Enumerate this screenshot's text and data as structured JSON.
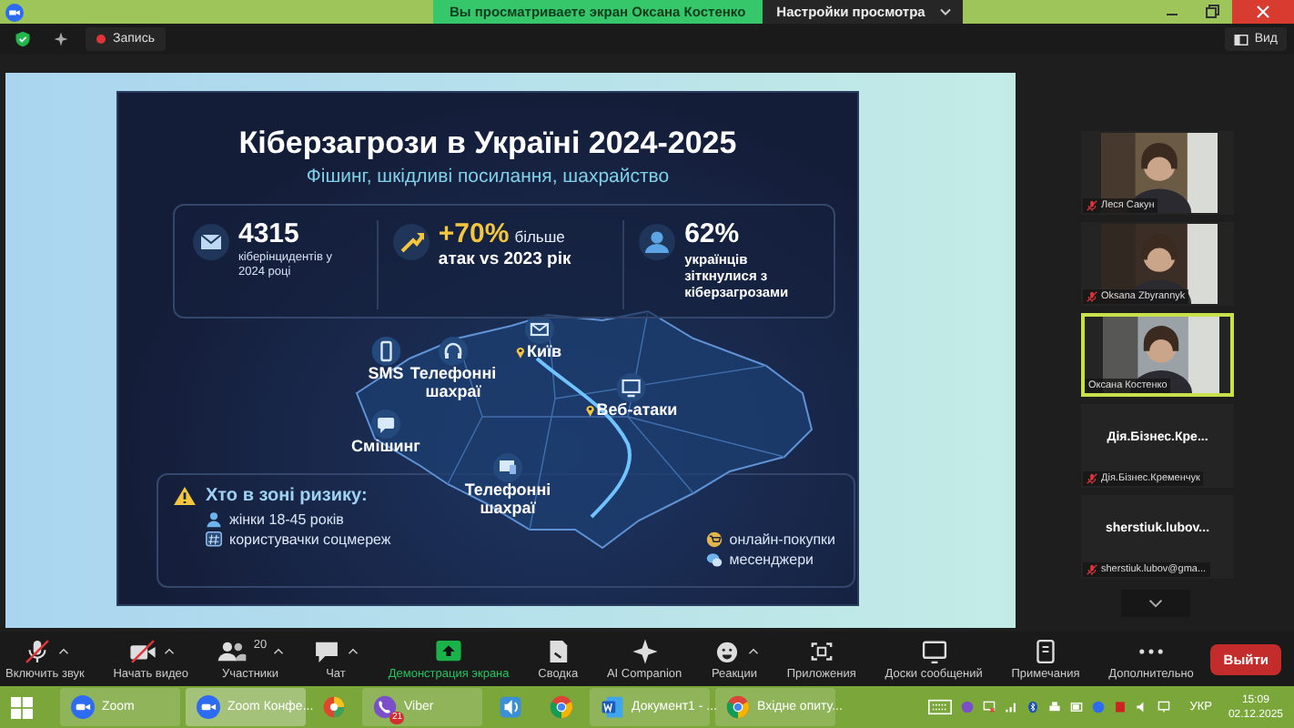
{
  "title_bar": {
    "banner": "Вы просматриваете экран Оксана Костенко",
    "view_options": "Настройки просмотра"
  },
  "meeting_bar": {
    "record": "Запись",
    "view": "Вид"
  },
  "slide": {
    "title": "Кіберзагрози в Україні 2024-2025",
    "subtitle": "Фішинг, шкідливі посилання, шахрайство",
    "stats": [
      {
        "kind": "mail",
        "value": "4315",
        "text": "кіберінцидентів у 2024 році"
      },
      {
        "kind": "growth",
        "value": "+70%",
        "suffix": "більше",
        "text": "атак vs 2023 рік"
      },
      {
        "kind": "person",
        "value": "62%",
        "text": "українців зіткнулися з кіберзагрозами"
      }
    ],
    "map_markers": [
      {
        "kind": "phone",
        "label": "SMS",
        "pin": false
      },
      {
        "kind": "headset",
        "label": "Телефонні шахраї",
        "pin": false
      },
      {
        "kind": "mail",
        "label": "Київ",
        "pin": true
      },
      {
        "kind": "monitor",
        "label": "Веб-атаки",
        "pin": true
      },
      {
        "kind": "chat",
        "label": "Смішинг",
        "pin": false
      },
      {
        "kind": "screen",
        "label": "Телефонні шахраї",
        "pin": false
      }
    ],
    "risk": {
      "title": "Хто в зоні ризику:",
      "groups": [
        {
          "kind": "person",
          "label": "жінки 18-45 років"
        },
        {
          "kind": "hash",
          "label": "користувачки соцмереж"
        }
      ],
      "channels": [
        {
          "kind": "shopping",
          "label": "онлайн-покупки"
        },
        {
          "kind": "chat",
          "label": "месенджери"
        }
      ]
    }
  },
  "participants": [
    {
      "kind": "video",
      "name": "Леся Сакун",
      "muted": true,
      "speaking": false
    },
    {
      "kind": "video",
      "name": "Oksana Zbyrannyk",
      "muted": true,
      "speaking": false
    },
    {
      "kind": "video",
      "name": "Оксана Костенко",
      "muted": false,
      "speaking": true
    },
    {
      "kind": "name",
      "display": "Дія.Бізнес.Кре...",
      "name": "Дія.Бізнес.Кременчук",
      "muted": true,
      "speaking": false
    },
    {
      "kind": "name",
      "display": "sherstiuk.lubov...",
      "name": "sherstiuk.lubov@gma...",
      "muted": true,
      "speaking": false
    }
  ],
  "toolbar": {
    "items": [
      {
        "kind": "mic",
        "label": "Включить звук",
        "off": true,
        "caret": true,
        "active": false
      },
      {
        "kind": "video",
        "label": "Начать видео",
        "off": true,
        "caret": true,
        "active": false
      },
      {
        "kind": "people",
        "label": "Участники",
        "count": "20",
        "off": false,
        "caret": true,
        "active": false
      },
      {
        "kind": "chat",
        "label": "Чат",
        "off": false,
        "caret": true,
        "active": false
      },
      {
        "kind": "share",
        "label": "Демонстрация экрана",
        "off": false,
        "caret": false,
        "active": true
      },
      {
        "kind": "summary",
        "label": "Сводка",
        "off": false,
        "caret": false,
        "active": false
      },
      {
        "kind": "ai",
        "label": "AI Companion",
        "off": false,
        "caret": false,
        "active": false
      },
      {
        "kind": "reactions",
        "label": "Реакции",
        "off": false,
        "caret": true,
        "active": false
      },
      {
        "kind": "apps",
        "label": "Приложения",
        "off": false,
        "caret": false,
        "active": false
      },
      {
        "kind": "whiteboard",
        "label": "Доски сообщений",
        "off": false,
        "caret": false,
        "active": false
      },
      {
        "kind": "notes",
        "label": "Примечания",
        "off": false,
        "caret": false,
        "active": false
      },
      {
        "kind": "more",
        "label": "Дополнительно",
        "off": false,
        "caret": false,
        "active": false
      }
    ],
    "leave": "Выйти"
  },
  "taskbar": {
    "items": [
      {
        "kind": "zoom",
        "label": "Zoom",
        "selected": false
      },
      {
        "kind": "zoom",
        "label": "Zoom Конфе...",
        "selected": true
      },
      {
        "kind": "colorful",
        "selected": false
      },
      {
        "kind": "viber",
        "label": "Viber",
        "badge": "21",
        "selected": false
      },
      {
        "kind": "speaker",
        "selected": false
      },
      {
        "kind": "chrome",
        "selected": false
      },
      {
        "kind": "word",
        "label": "Документ1 - ...",
        "selected": false
      },
      {
        "kind": "chrome",
        "label": "Вхідне опиту...",
        "selected": false
      }
    ],
    "language": "УКР",
    "time": "15:09",
    "date": "02.12.2025"
  }
}
